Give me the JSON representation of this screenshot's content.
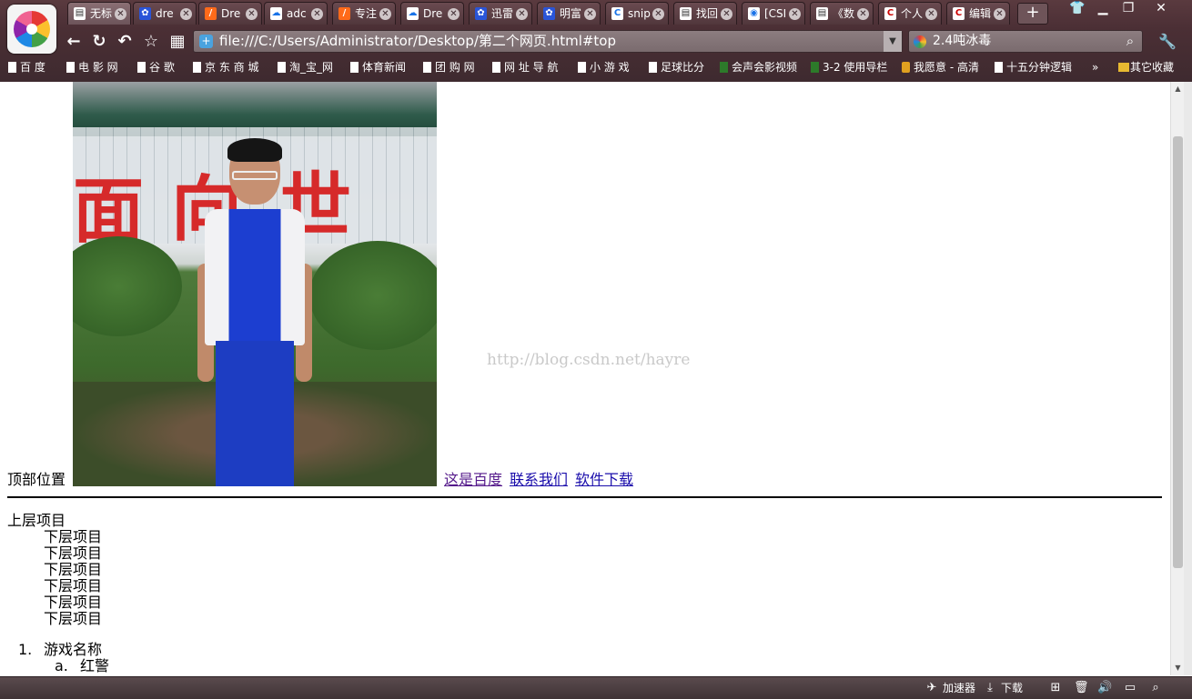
{
  "browser": {
    "tabs": [
      {
        "label": "无标",
        "icon": "page-icon",
        "active": true
      },
      {
        "label": "dre",
        "icon": "paw-icon"
      },
      {
        "label": "Dre",
        "icon": "dreamweaver-icon"
      },
      {
        "label": "adc",
        "icon": "cloud-icon"
      },
      {
        "label": "专注",
        "icon": "dreamweaver-icon"
      },
      {
        "label": "Dre",
        "icon": "cloud-icon"
      },
      {
        "label": "迅雷",
        "icon": "paw-icon"
      },
      {
        "label": "明富",
        "icon": "paw-icon"
      },
      {
        "label": "snip",
        "icon": "c-icon"
      },
      {
        "label": "找回",
        "icon": "page-icon"
      },
      {
        "label": "[CSI",
        "icon": "chrome-icon"
      },
      {
        "label": "《数",
        "icon": "page-icon"
      },
      {
        "label": "个人",
        "icon": "csdn-icon"
      },
      {
        "label": "编辑",
        "icon": "csdn-icon"
      }
    ],
    "address": "file:///C:/Users/Administrator/Desktop/第二个网页.html#top",
    "search_value": "2.4吨冰毒",
    "bookmarks": [
      {
        "label": "百 度"
      },
      {
        "label": "电 影 网"
      },
      {
        "label": "谷 歌"
      },
      {
        "label": "京 东 商 城"
      },
      {
        "label": "淘_宝_网"
      },
      {
        "label": "体育新闻"
      },
      {
        "label": "团 购 网"
      },
      {
        "label": "网 址 导 航"
      },
      {
        "label": "小 游 戏"
      },
      {
        "label": "足球比分"
      },
      {
        "label": "会声会影视频"
      },
      {
        "label": "3-2 使用导栏"
      },
      {
        "label": "我愿意 - 高清"
      },
      {
        "label": "十五分钟逻辑"
      }
    ],
    "bookmarks_overflow": "»",
    "other_bookmarks": "其它收藏",
    "status": {
      "accelerator": "加速器",
      "download": "下载"
    }
  },
  "page": {
    "top_label": "顶部位置",
    "links": [
      "这是百度",
      "联系我们",
      "软件下载"
    ],
    "photo_chars": [
      "面",
      "向",
      "世"
    ],
    "watermark": "http://blog.csdn.net/hayre",
    "ul_top": "上层项目",
    "ul_sub": [
      "下层项目",
      "下层项目",
      "下层项目",
      "下层项目",
      "下层项目",
      "下层项目"
    ],
    "ol_item_number": "1.",
    "ol_item": "游戏名称",
    "ol_sub_letter": "a.",
    "ol_sub_item": "红警"
  }
}
